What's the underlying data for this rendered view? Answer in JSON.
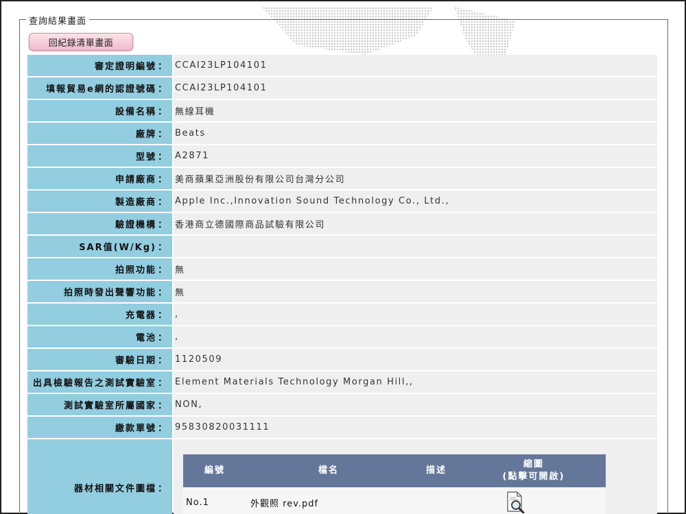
{
  "fieldset_legend": "查詢結果畫面",
  "back_button": "回紀錄清單畫面",
  "rows": [
    {
      "label": "審定證明編號",
      "value": "CCAI23LP104101"
    },
    {
      "label": "填報貿易e網的認證號碼",
      "value": "CCAI23LP104101"
    },
    {
      "label": "設備名稱",
      "value": "無線耳機"
    },
    {
      "label": "廠牌",
      "value": "Beats"
    },
    {
      "label": "型號",
      "value": "A2871"
    },
    {
      "label": "申請廠商",
      "value": "美商蘋果亞洲股份有限公司台灣分公司"
    },
    {
      "label": "製造廠商",
      "value": "Apple Inc.,Innovation Sound Technology Co., Ltd.,"
    },
    {
      "label": "驗證機構",
      "value": "香港商立德國際商品試驗有限公司"
    },
    {
      "label": "SAR值(W/Kg)",
      "value": ""
    },
    {
      "label": "拍照功能",
      "value": "無"
    },
    {
      "label": "拍照時發出聲響功能",
      "value": "無"
    },
    {
      "label": "充電器",
      "value": ","
    },
    {
      "label": "電池",
      "value": ","
    },
    {
      "label": "審驗日期",
      "value": "1120509"
    },
    {
      "label": "出具檢驗報告之測試實驗室",
      "value": "Element Materials Technology Morgan Hill,,"
    },
    {
      "label": "測試實驗室所屬國家",
      "value": "NON,"
    },
    {
      "label": "繳款單號",
      "value": "95830820031111"
    }
  ],
  "colon": "：",
  "files_label": "器材相關文件圖檔",
  "files_table": {
    "headers": {
      "no": "編號",
      "filename": "檔名",
      "desc": "描述",
      "thumb_line1": "縮圖",
      "thumb_line2": "(點擊可開啟)"
    },
    "rows": [
      {
        "no": "No.1",
        "filename": "外觀照 rev.pdf",
        "desc": "",
        "thumb_icon": "document-magnifier-icon"
      }
    ]
  },
  "colors": {
    "label_bg": "#93cde0",
    "value_bg": "#efefef",
    "table_header_bg": "#64779a",
    "button_bg": "#f0bccb"
  }
}
